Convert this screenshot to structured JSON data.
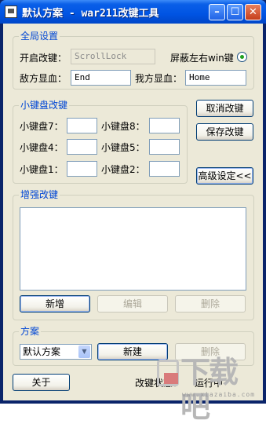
{
  "window": {
    "title": "默认方案 - war211改键工具"
  },
  "global": {
    "group_title": "全局设置",
    "hotkey_label": "开启改键：",
    "hotkey_value": "ScrollLock",
    "block_win_label": "屏蔽左右win键",
    "enemy_hp_label": "敌方显血：",
    "enemy_hp_value": "End",
    "self_hp_label": "我方显血：",
    "self_hp_value": "Home"
  },
  "numpad": {
    "group_title": "小键盘改键",
    "n7": "小键盘7：",
    "n8": "小键盘8：",
    "n4": "小键盘4：",
    "n5": "小键盘5：",
    "n1": "小键盘1：",
    "n2": "小键盘2："
  },
  "side_buttons": {
    "cancel": "取消改键",
    "save": "保存改键",
    "advanced": "高级设定<<"
  },
  "enhanced": {
    "group_title": "增强改键",
    "add": "新增",
    "edit": "编辑",
    "delete": "删除"
  },
  "scheme": {
    "group_title": "方案",
    "selected": "默认方案",
    "new": "新建",
    "delete": "删除"
  },
  "footer": {
    "about": "关于",
    "status_label": "改键状态：",
    "status_value": "运行中"
  },
  "watermark": {
    "text": "下载吧",
    "url": "www.xiazaiba.com"
  }
}
